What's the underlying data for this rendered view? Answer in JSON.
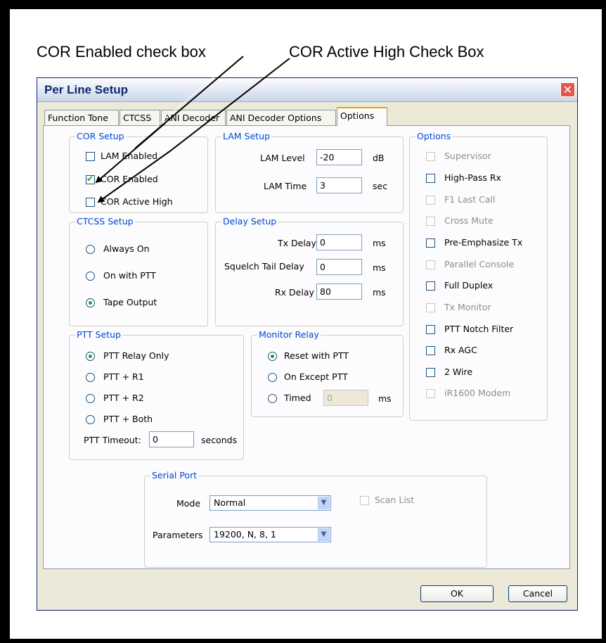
{
  "callouts": {
    "cor_enabled": "COR Enabled check box",
    "cor_active_high": "COR Active High Check Box"
  },
  "dialog": {
    "title": "Per Line Setup",
    "close_glyph": "✕",
    "tabs": [
      "Function Tone",
      "CTCSS",
      "ANI Decoder",
      "ANI Decoder Options",
      "Options"
    ],
    "active_tab": "Options"
  },
  "cor_setup": {
    "legend": "COR Setup",
    "lam_enabled": {
      "label": "LAM Enabled",
      "checked": false
    },
    "cor_enabled": {
      "label": "COR Enabled",
      "checked": true
    },
    "cor_active_high": {
      "label": "COR Active High",
      "checked": false
    }
  },
  "lam_setup": {
    "legend": "LAM Setup",
    "lam_level_label": "LAM Level",
    "lam_level_value": "-20",
    "lam_level_unit": "dB",
    "lam_time_label": "LAM Time",
    "lam_time_value": "3",
    "lam_time_unit": "sec"
  },
  "ctcss_setup": {
    "legend": "CTCSS Setup",
    "options": [
      "Always On",
      "On with PTT",
      "Tape Output"
    ],
    "selected": "Tape Output"
  },
  "delay_setup": {
    "legend": "Delay Setup",
    "tx_label": "Tx Delay",
    "tx_value": "0",
    "tx_unit": "ms",
    "squelch_label": "Squelch Tail Delay",
    "squelch_value": "0",
    "squelch_unit": "ms",
    "rx_label": "Rx Delay",
    "rx_value": "80",
    "rx_unit": "ms"
  },
  "ptt_setup": {
    "legend": "PTT Setup",
    "options": [
      "PTT Relay Only",
      "PTT + R1",
      "PTT + R2",
      "PTT + Both"
    ],
    "selected": "PTT Relay Only",
    "timeout_label": "PTT Timeout:",
    "timeout_value": "0",
    "timeout_unit": "seconds"
  },
  "monitor_relay": {
    "legend": "Monitor Relay",
    "options": [
      "Reset with PTT",
      "On Except PTT",
      "Timed"
    ],
    "selected": "Reset with PTT",
    "timed_value": "0",
    "timed_unit": "ms"
  },
  "options": {
    "legend": "Options",
    "items": [
      {
        "label": "Supervisor",
        "enabled": false,
        "checked": false
      },
      {
        "label": "High-Pass Rx",
        "enabled": true,
        "checked": false
      },
      {
        "label": "F1 Last Call",
        "enabled": false,
        "checked": false
      },
      {
        "label": "Cross Mute",
        "enabled": false,
        "checked": false
      },
      {
        "label": "Pre-Emphasize Tx",
        "enabled": true,
        "checked": false
      },
      {
        "label": "Parallel Console",
        "enabled": false,
        "checked": false
      },
      {
        "label": "Full Duplex",
        "enabled": true,
        "checked": false
      },
      {
        "label": "Tx Monitor",
        "enabled": false,
        "checked": false
      },
      {
        "label": "PTT Notch Filter",
        "enabled": true,
        "checked": false
      },
      {
        "label": "Rx AGC",
        "enabled": true,
        "checked": false
      },
      {
        "label": "2 Wire",
        "enabled": true,
        "checked": false
      },
      {
        "label": "iR1600 Modem",
        "enabled": false,
        "checked": false
      }
    ]
  },
  "serial_port": {
    "legend": "Serial Port",
    "mode_label": "Mode",
    "mode_value": "Normal",
    "scan_list_label": "Scan List",
    "parameters_label": "Parameters",
    "parameters_value": "19200, N, 8, 1"
  },
  "buttons": {
    "ok": "OK",
    "cancel": "Cancel"
  }
}
